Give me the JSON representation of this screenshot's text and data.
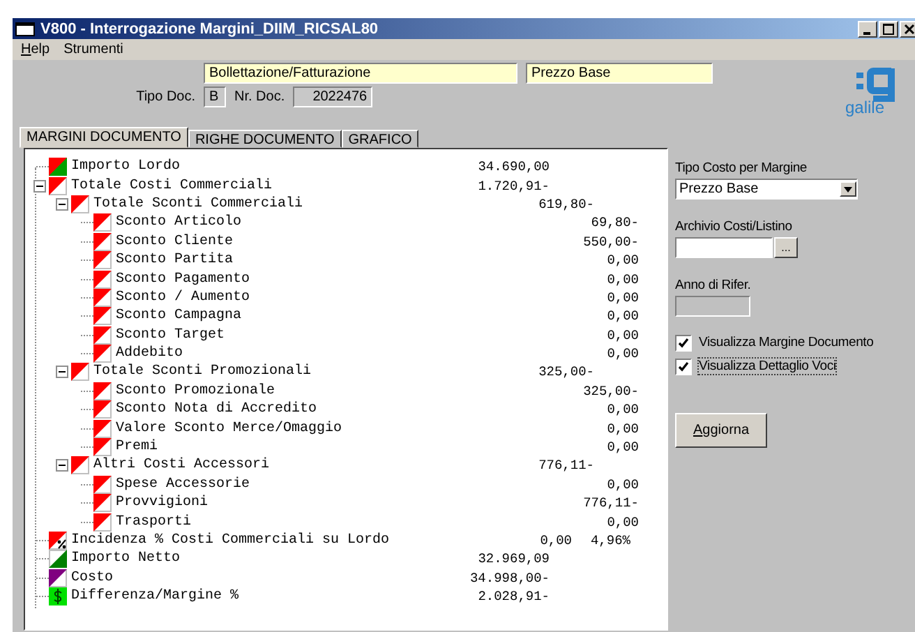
{
  "window": {
    "title": "V800 - Interrogazione Margini_DIIM_RICSAL80"
  },
  "menu": [
    "Help",
    "Strumenti"
  ],
  "header": {
    "doc_category": "Bollettazione/Fatturazione",
    "price_type": "Prezzo Base",
    "tipo_doc": {
      "label": "Tipo Doc.",
      "value": "B"
    },
    "nr_doc": {
      "label": "Nr. Doc.",
      "value": "2022476"
    },
    "logo_text": "galile"
  },
  "tabs": [
    {
      "label": "MARGINI DOCUMENTO",
      "selected": true
    },
    {
      "label": "RIGHE DOCUMENTO",
      "selected": false
    },
    {
      "label": "GRAFICO",
      "selected": false
    }
  ],
  "tree": [
    {
      "label": "Importo Lordo",
      "kind": "revenue",
      "value": "34.690,00"
    },
    {
      "label": "Totale Costi Commerciali",
      "kind": "cost",
      "value": "1.720,91-",
      "expanded": true,
      "children": [
        {
          "label": "Totale Sconti Commerciali",
          "kind": "cost",
          "value": "619,80-",
          "expanded": true,
          "children": [
            {
              "label": "Sconto Articolo",
              "kind": "cost",
              "value": "69,80-"
            },
            {
              "label": "Sconto Cliente",
              "kind": "cost",
              "value": "550,00-"
            },
            {
              "label": "Sconto Partita",
              "kind": "cost",
              "value": "0,00"
            },
            {
              "label": "Sconto Pagamento",
              "kind": "cost",
              "value": "0,00"
            },
            {
              "label": "Sconto / Aumento",
              "kind": "cost",
              "value": "0,00"
            },
            {
              "label": "Sconto Campagna",
              "kind": "cost",
              "value": "0,00"
            },
            {
              "label": "Sconto Target",
              "kind": "cost",
              "value": "0,00"
            },
            {
              "label": "Addebito",
              "kind": "cost",
              "value": "0,00"
            }
          ]
        },
        {
          "label": "Totale Sconti Promozionali",
          "kind": "cost",
          "value": "325,00-",
          "expanded": true,
          "children": [
            {
              "label": "Sconto Promozionale",
              "kind": "cost",
              "value": "325,00-"
            },
            {
              "label": "Sconto Nota di Accredito",
              "kind": "cost",
              "value": "0,00"
            },
            {
              "label": "Valore Sconto Merce/Omaggio",
              "kind": "cost",
              "value": "0,00"
            },
            {
              "label": "Premi",
              "kind": "cost",
              "value": "0,00"
            }
          ]
        },
        {
          "label": "Altri Costi Accessori",
          "kind": "cost",
          "value": "776,11-",
          "expanded": true,
          "children": [
            {
              "label": "Spese Accessorie",
              "kind": "cost",
              "value": "0,00"
            },
            {
              "label": "Provvigioni",
              "kind": "cost",
              "value": "776,11-"
            },
            {
              "label": "Trasporti",
              "kind": "cost",
              "value": "0,00"
            }
          ]
        }
      ]
    },
    {
      "label": "Incidenza % Costi Commerciali su Lordo",
      "kind": "percent",
      "value": "0,00",
      "value_2": "4,96%"
    },
    {
      "label": "Importo Netto",
      "kind": "net",
      "value": "32.969,09"
    },
    {
      "label": "Costo",
      "kind": "total_cost",
      "value": "34.998,00-"
    },
    {
      "label": "Differenza/Margine %",
      "kind": "margin",
      "value": "2.028,91-"
    }
  ],
  "side": {
    "cost_type": {
      "label": "Tipo Costo per Margine",
      "value": "Prezzo Base"
    },
    "archive": {
      "label": "Archivio Costi/Listino",
      "button": "..."
    },
    "year": {
      "label": "Anno di Rifer."
    },
    "checkboxes": [
      {
        "label": "Visualizza Margine Documento",
        "checked": true
      },
      {
        "label": "Visualizza Dettaglio Voci",
        "checked": true
      }
    ],
    "refresh_button": "Aggiorna"
  }
}
